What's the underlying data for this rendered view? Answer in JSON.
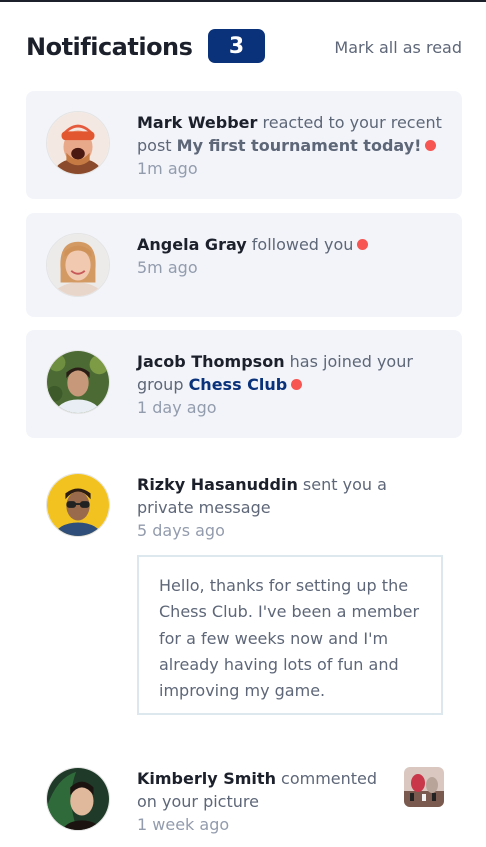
{
  "header": {
    "title": "Notifications",
    "unread_count": "3",
    "mark_all": "Mark all as read"
  },
  "notifications": [
    {
      "name": "Mark Webber",
      "action": " reacted to your recent post ",
      "target": "My first tournament today!",
      "time": "1m ago",
      "unread": true,
      "avatar_icon": "avatar-mark-webber"
    },
    {
      "name": "Angela Gray",
      "action": " followed you",
      "time": "5m ago",
      "unread": true,
      "avatar_icon": "avatar-angela-gray"
    },
    {
      "name": "Jacob Thompson",
      "action": " has joined your group ",
      "target": "Chess Club",
      "time": "1 day ago",
      "unread": true,
      "avatar_icon": "avatar-jacob-thompson"
    },
    {
      "name": "Rizky Hasanuddin",
      "action": " sent you a private message",
      "time": "5 days ago",
      "unread": false,
      "message": "Hello, thanks for setting up the Chess Club. I've been a member for a few weeks now and I'm already having lots of fun and improving my game.",
      "avatar_icon": "avatar-rizky-hasanuddin"
    },
    {
      "name": "Kimberly Smith",
      "action": " commented on your picture",
      "time": "1 week ago",
      "unread": false,
      "avatar_icon": "avatar-kimberly-smith",
      "thumbnail_icon": "chess-picture-thumbnail"
    }
  ],
  "colors": {
    "unread_bg": "#f2f4f9",
    "badge": "#0a327b",
    "dot": "#f65552",
    "name": "#1c202b",
    "text": "#5e6778",
    "time": "#939cad"
  }
}
